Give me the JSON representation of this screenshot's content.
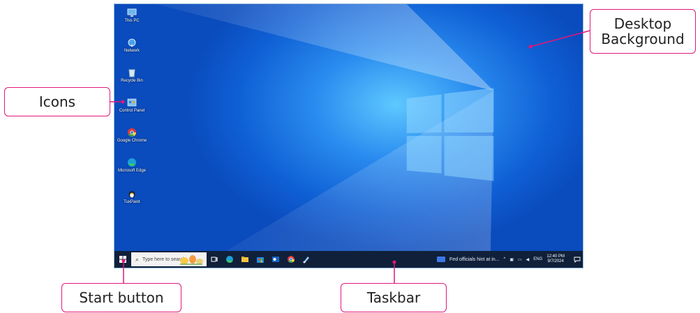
{
  "desktop": {
    "icons": [
      {
        "label": "This PC",
        "icon": "computer-icon"
      },
      {
        "label": "Network",
        "icon": "network-icon"
      },
      {
        "label": "Recycle Bin",
        "icon": "recycle-bin-icon"
      },
      {
        "label": "Control Panel",
        "icon": "control-panel-icon"
      },
      {
        "label": "Google Chrome",
        "icon": "chrome-icon"
      },
      {
        "label": "Microsoft Edge",
        "icon": "edge-icon"
      },
      {
        "label": "TuxPaint",
        "icon": "tuxpaint-icon"
      }
    ]
  },
  "taskbar": {
    "search_placeholder": "Type here to search",
    "apps": [
      "task-view-icon",
      "edge-icon",
      "file-explorer-icon",
      "store-icon",
      "outlook-icon",
      "chrome-icon",
      "paint-icon"
    ],
    "news_text": "Fed officials hint at in...",
    "language": "ENG",
    "time": "12:40 PM",
    "date": "9/7/2024"
  },
  "callouts": {
    "icons": "Icons",
    "desktop_background_line1": "Desktop",
    "desktop_background_line2": "Background",
    "start_button": "Start button",
    "taskbar": "Taskbar"
  },
  "colors": {
    "accent": "#e0177a",
    "desktop_blue": "#0f5fd4",
    "taskbar": "#10203a"
  }
}
